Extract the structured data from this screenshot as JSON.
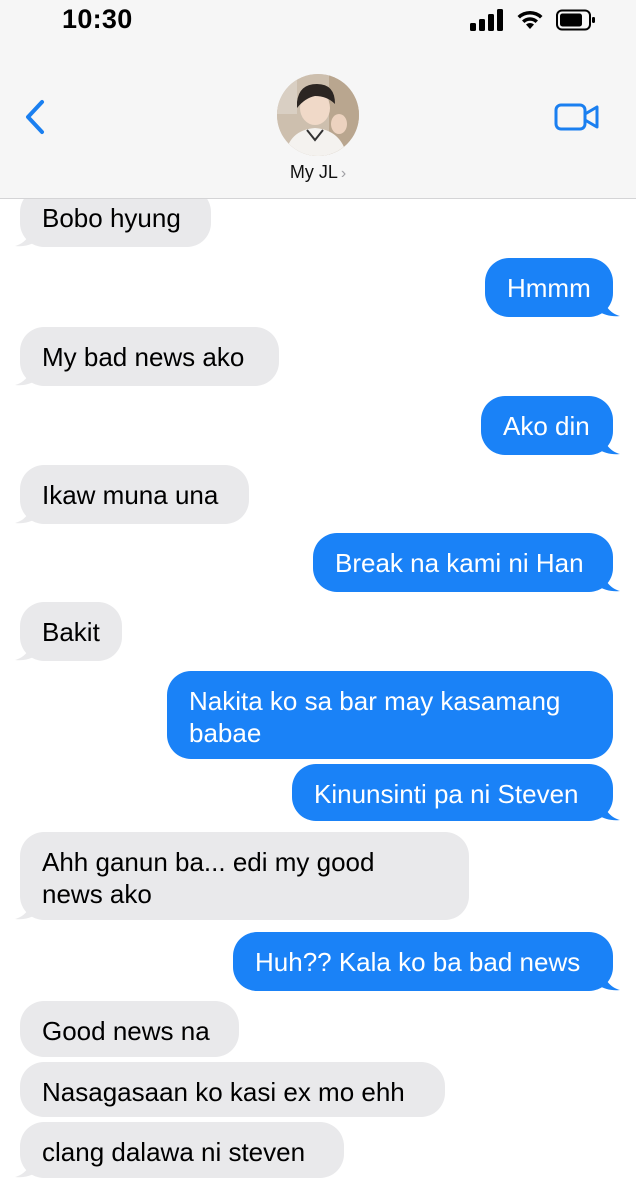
{
  "status_bar": {
    "time": "10:30"
  },
  "header": {
    "contact_name": "My JL",
    "chevron": "›"
  },
  "colors": {
    "incoming": "#e9e9eb",
    "outgoing": "#1a82f7",
    "accent": "#1a7ff0"
  },
  "icons": [
    "signal-icon",
    "wifi-icon",
    "battery-icon",
    "back-chevron-icon",
    "video-call-icon"
  ],
  "messages": [
    {
      "dir": "in",
      "text": "Bobo hyung"
    },
    {
      "dir": "out",
      "text": "Hmmm"
    },
    {
      "dir": "in",
      "text": "My bad news ako"
    },
    {
      "dir": "out",
      "text": "Ako din"
    },
    {
      "dir": "in",
      "text": "Ikaw muna una"
    },
    {
      "dir": "out",
      "text": "Break na kami ni Han"
    },
    {
      "dir": "in",
      "text": "Bakit"
    },
    {
      "dir": "out",
      "text": "Nakita ko sa bar may kasamang\nbabae"
    },
    {
      "dir": "out",
      "text": "Kinunsinti pa ni Steven"
    },
    {
      "dir": "in",
      "text": "Ahh ganun ba... edi my good\nnews ako"
    },
    {
      "dir": "out",
      "text": "Huh?? Kala ko ba bad news"
    },
    {
      "dir": "in",
      "text": "Good news na"
    },
    {
      "dir": "in",
      "text": "Nasagasaan ko kasi ex mo ehh"
    },
    {
      "dir": "in",
      "text": "clang dalawa ni steven"
    }
  ]
}
